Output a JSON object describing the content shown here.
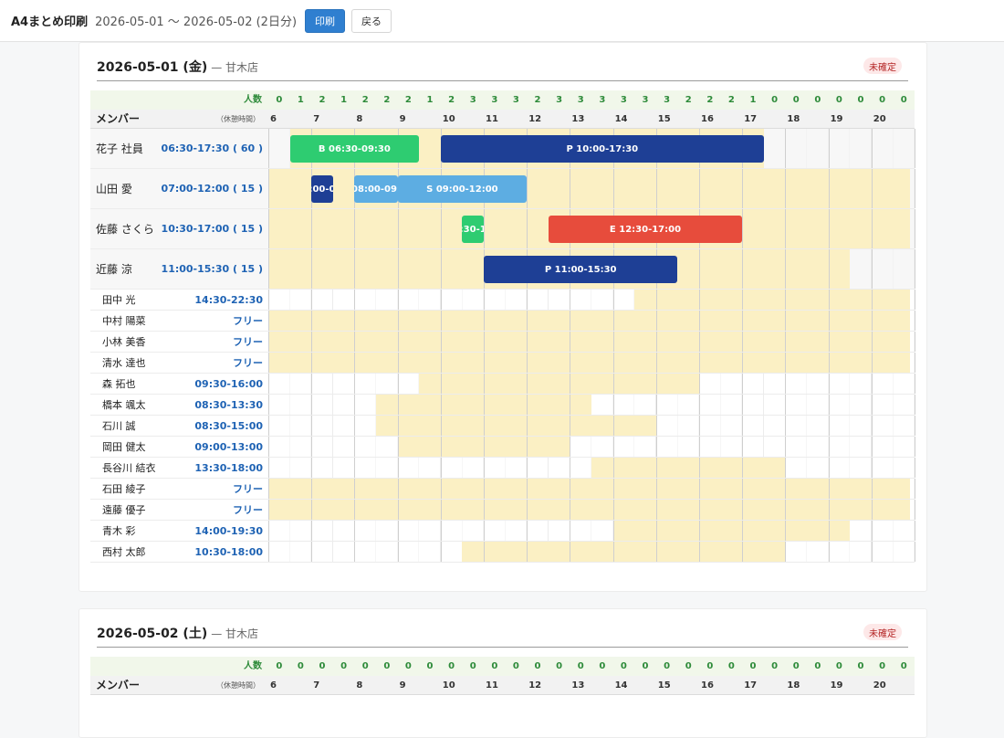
{
  "header": {
    "title": "A4まとめ印刷",
    "range": "2026-05-01 〜 2026-05-02 (2日分)",
    "print_label": "印刷",
    "back_label": "戻る"
  },
  "colors": {
    "B": "#2ecc71",
    "P": "#1e3f95",
    "S": "#5dade2",
    "E": "#e74c3c",
    "availability": "#fbf0c4",
    "count": "#2e8b3a",
    "time": "#1f63b4"
  },
  "days": [
    {
      "date": "2026-05-01 (金)",
      "store": "— 甘木店",
      "status": "未確定",
      "count_label": "人数",
      "member_label": "メンバー",
      "break_label": "（休憩時間）",
      "hours": [
        "6",
        "7",
        "8",
        "9",
        "10",
        "11",
        "12",
        "13",
        "14",
        "15",
        "16",
        "17",
        "18",
        "19",
        "20"
      ],
      "counts": [
        "0",
        "1",
        "2",
        "1",
        "2",
        "2",
        "2",
        "1",
        "2",
        "3",
        "3",
        "3",
        "2",
        "3",
        "3",
        "3",
        "3",
        "3",
        "3",
        "2",
        "2",
        "2",
        "1",
        "0",
        "0",
        "0",
        "0",
        "0",
        "0",
        "0"
      ],
      "members": [
        {
          "name": "花子 社員",
          "time": "06:30-17:30 ( 60 )",
          "avail": [
            [
              6.5,
              17.5
            ]
          ],
          "shifts": [
            {
              "label": "B 06:30-09:30",
              "code": "B",
              "start": 6.5,
              "end": 9.5
            },
            {
              "label": "P 10:00-17:30",
              "code": "P",
              "start": 10,
              "end": 17.5
            }
          ]
        },
        {
          "name": "山田 愛",
          "time": "07:00-12:00 ( 15 )",
          "avail": [
            [
              6,
              20.9
            ]
          ],
          "shifts": [
            {
              "label": ":00-0",
              "code": "P",
              "start": 7,
              "end": 7.5
            },
            {
              "label": "08:00-09:",
              "code": "S",
              "start": 8,
              "end": 9
            },
            {
              "label": "S 09:00-12:00",
              "code": "S",
              "start": 9,
              "end": 12
            }
          ]
        },
        {
          "name": "佐藤 さくら",
          "time": "10:30-17:00 ( 15 )",
          "avail": [
            [
              6,
              20.9
            ]
          ],
          "shifts": [
            {
              "label": ":30-1",
              "code": "B",
              "start": 10.5,
              "end": 11
            },
            {
              "label": "E 12:30-17:00",
              "code": "E",
              "start": 12.5,
              "end": 17
            }
          ]
        },
        {
          "name": "近藤 涼",
          "time": "11:00-15:30 ( 15 )",
          "avail": [
            [
              6,
              19.5
            ]
          ],
          "shifts": [
            {
              "label": "P 11:00-15:30",
              "code": "P",
              "start": 11,
              "end": 15.5
            }
          ]
        },
        {
          "name": "田中 光",
          "time": "14:30-22:30",
          "avail": [
            [
              14.5,
              20.9
            ]
          ],
          "shifts": []
        },
        {
          "name": "中村 陽菜",
          "time": "フリー",
          "avail": [
            [
              6,
              20.9
            ]
          ],
          "shifts": []
        },
        {
          "name": "小林 美香",
          "time": "フリー",
          "avail": [
            [
              6,
              20.9
            ]
          ],
          "shifts": []
        },
        {
          "name": "清水 達也",
          "time": "フリー",
          "avail": [
            [
              6,
              20.9
            ]
          ],
          "shifts": []
        },
        {
          "name": "森 拓也",
          "time": "09:30-16:00",
          "avail": [
            [
              9.5,
              16
            ]
          ],
          "shifts": []
        },
        {
          "name": "橋本 颯太",
          "time": "08:30-13:30",
          "avail": [
            [
              8.5,
              13.5
            ]
          ],
          "shifts": []
        },
        {
          "name": "石川 誠",
          "time": "08:30-15:00",
          "avail": [
            [
              8.5,
              15
            ]
          ],
          "shifts": []
        },
        {
          "name": "岡田 健太",
          "time": "09:00-13:00",
          "avail": [
            [
              9,
              13
            ]
          ],
          "shifts": []
        },
        {
          "name": "長谷川 結衣",
          "time": "13:30-18:00",
          "avail": [
            [
              13.5,
              18
            ]
          ],
          "shifts": []
        },
        {
          "name": "石田 綾子",
          "time": "フリー",
          "avail": [
            [
              6,
              20.9
            ]
          ],
          "shifts": []
        },
        {
          "name": "遠藤 優子",
          "time": "フリー",
          "avail": [
            [
              6,
              20.9
            ]
          ],
          "shifts": []
        },
        {
          "name": "青木 彩",
          "time": "14:00-19:30",
          "avail": [
            [
              14,
              19.5
            ]
          ],
          "shifts": []
        },
        {
          "name": "西村 太郎",
          "time": "10:30-18:00",
          "avail": [
            [
              10.5,
              18
            ]
          ],
          "shifts": []
        }
      ]
    },
    {
      "date": "2026-05-02 (土)",
      "store": "— 甘木店",
      "status": "未確定",
      "count_label": "人数",
      "member_label": "メンバー",
      "break_label": "（休憩時間）",
      "hours": [
        "6",
        "7",
        "8",
        "9",
        "10",
        "11",
        "12",
        "13",
        "14",
        "15",
        "16",
        "17",
        "18",
        "19",
        "20"
      ],
      "counts": [
        "0",
        "0",
        "0",
        "0",
        "0",
        "0",
        "0",
        "0",
        "0",
        "0",
        "0",
        "0",
        "0",
        "0",
        "0",
        "0",
        "0",
        "0",
        "0",
        "0",
        "0",
        "0",
        "0",
        "0",
        "0",
        "0",
        "0",
        "0",
        "0",
        "0"
      ],
      "members": []
    }
  ]
}
